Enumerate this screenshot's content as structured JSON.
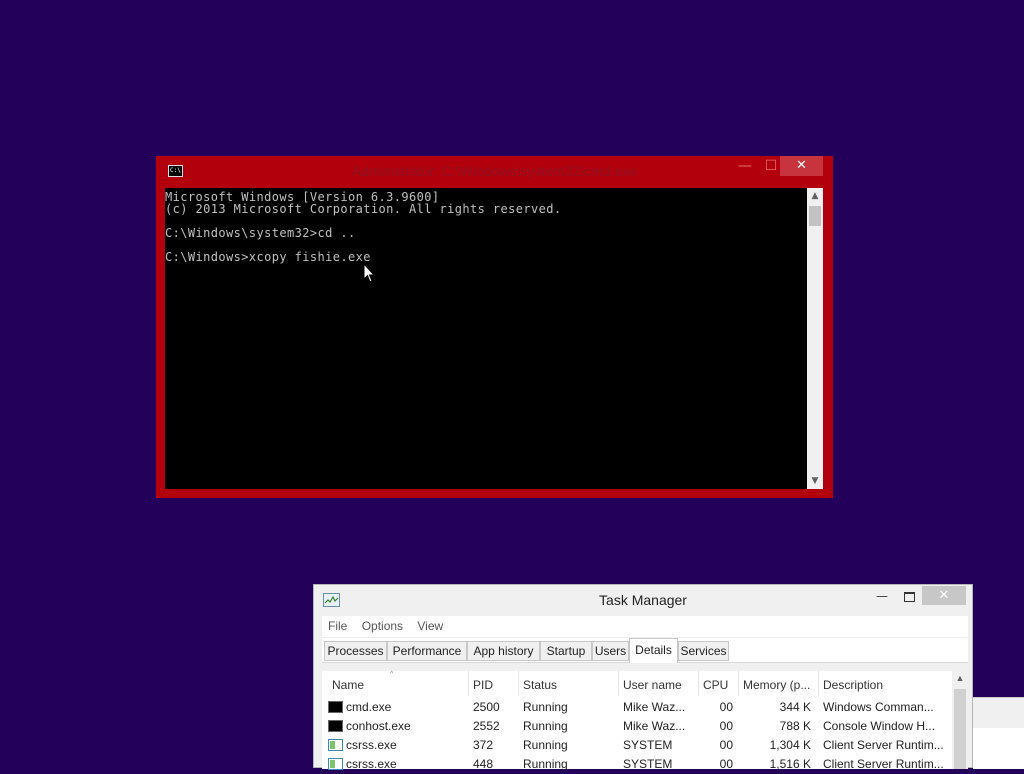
{
  "cmd_window": {
    "title": "Administrator: C:\\Windows\\system32\\cmd.exe",
    "icon": "console-icon",
    "close_glyph": "✕",
    "min_glyph": "—",
    "max_glyph": "☐",
    "console_text": "Microsoft Windows [Version 6.3.9600]\n(c) 2013 Microsoft Corporation. All rights reserved.\n\nC:\\Windows\\system32>cd ..\n\nC:\\Windows>xcopy fishie.exe",
    "scroll_up": "▲",
    "scroll_down": "▼"
  },
  "task_manager": {
    "title": "Task Manager",
    "icon": "task-manager-icon",
    "min_glyph": "—",
    "close_glyph": "✕",
    "menu": [
      "File",
      "Options",
      "View"
    ],
    "tabs": [
      "Processes",
      "Performance",
      "App history",
      "Startup",
      "Users",
      "Details",
      "Services"
    ],
    "active_tab": "Details",
    "columns": [
      "Name",
      "PID",
      "Status",
      "User name",
      "CPU",
      "Memory (p...",
      "Description"
    ],
    "sort_arrow": "^",
    "rows": [
      {
        "name": "cmd.exe",
        "pid": "2500",
        "status": "Running",
        "user": "Mike Waz...",
        "cpu": "00",
        "memory": "344 K",
        "description": "Windows Comman...",
        "icon": "console"
      },
      {
        "name": "conhost.exe",
        "pid": "2552",
        "status": "Running",
        "user": "Mike Waz...",
        "cpu": "00",
        "memory": "788 K",
        "description": "Console Window H...",
        "icon": "console"
      },
      {
        "name": "csrss.exe",
        "pid": "372",
        "status": "Running",
        "user": "SYSTEM",
        "cpu": "00",
        "memory": "1,304 K",
        "description": "Client Server Runtim...",
        "icon": "window"
      },
      {
        "name": "csrss.exe",
        "pid": "448",
        "status": "Running",
        "user": "SYSTEM",
        "cpu": "00",
        "memory": "1,516 K",
        "description": "Client Server Runtim...",
        "icon": "window"
      }
    ],
    "scroll_up": "▲"
  },
  "colors": {
    "desktop": "#23005a",
    "cmd_frame": "#b3000d",
    "close_red": "#c7343d"
  }
}
